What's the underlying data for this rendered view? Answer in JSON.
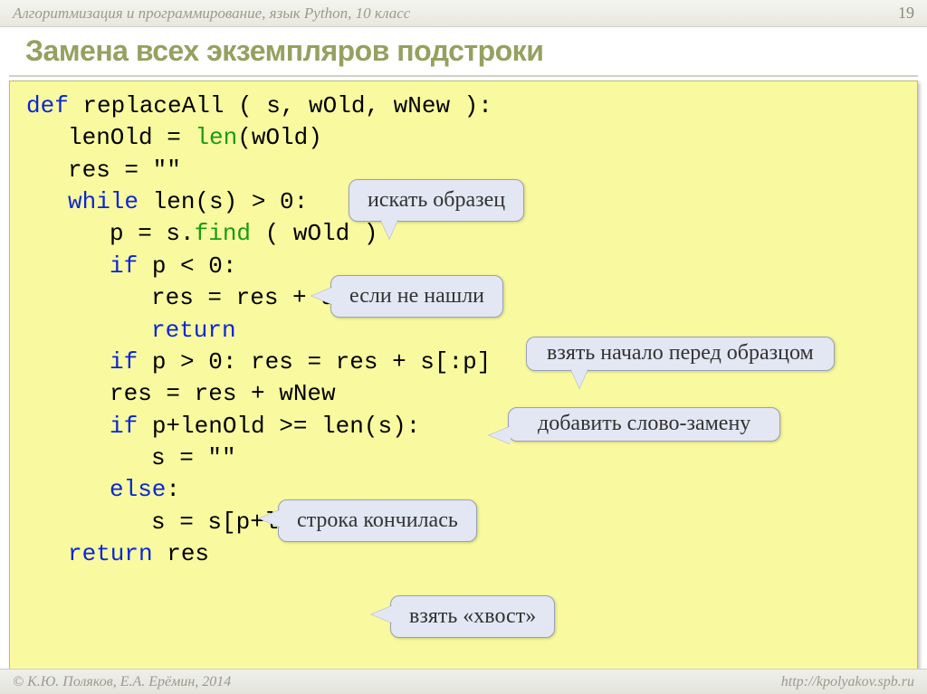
{
  "header": {
    "course": "Алгоритмизация и программирование, язык Python, 10 класс",
    "page": "19"
  },
  "title": "Замена всех экземпляров подстроки",
  "code": {
    "l1_def": "def",
    "l1_rest": " replaceAll ( s, wOld, wNew ):",
    "l2a": "lenOld = ",
    "l2_len": "len",
    "l2b": "(wOld)",
    "l3": "res = \"\"",
    "l4_while": "while",
    "l4a": " len(s) > 0:",
    "l5a": "p = s.",
    "l5_find": "find",
    "l5b": " ( wOld )",
    "l6_if": "if",
    "l6a": " p < 0:",
    "l7": "res = res + s",
    "l8_return": "return",
    "l9_if": "if",
    "l9a": " p > 0:  res = res + s[:p]",
    "l10": "res = res + wNew",
    "l11_if": "if",
    "l11a": " p+lenOld >= len(s):",
    "l12": "s = \"\"",
    "l13_else": "else",
    "l13a": ":",
    "l14": "s = s[p+lenOld:]",
    "l15_return": "return",
    "l15a": " res"
  },
  "callouts": {
    "c1": "искать образец",
    "c2": "если не нашли",
    "c3": "взять начало перед образцом",
    "c4": "добавить слово-замену",
    "c5": "строка кончилась",
    "c6": "взять «хвост»"
  },
  "footer": {
    "authors": "© К.Ю. Поляков, Е.А. Ерёмин, 2014",
    "url": "http://kpolyakov.spb.ru"
  }
}
